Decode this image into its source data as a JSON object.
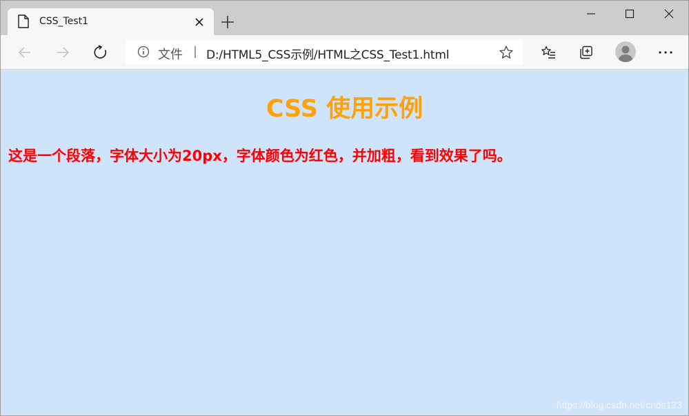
{
  "tab": {
    "title": "CSS_Test1",
    "close_icon": "close-icon",
    "page_icon": "page-icon"
  },
  "window_controls": {
    "minimize_icon": "minimize-icon",
    "maximize_icon": "maximize-icon",
    "close_icon": "close-icon"
  },
  "toolbar": {
    "address": {
      "site_label": "文件",
      "separator": "|",
      "url": "D:/HTML5_CSS示例/HTML之CSS_Test1.html"
    },
    "icons": {
      "back": "back-arrow-icon",
      "forward": "forward-arrow-icon",
      "refresh": "refresh-icon",
      "info": "info-icon",
      "favorite": "star-icon",
      "favorites_list": "favorites-list-icon",
      "collections": "collections-icon",
      "profile": "profile-icon",
      "more": "more-icon"
    }
  },
  "page": {
    "heading": "CSS 使用示例",
    "paragraph": "这是一个段落，字体大小为20px，字体颜色为红色，并加粗，看到效果了吗。",
    "watermark": "https://blog.csdn.net/cnds123"
  },
  "colors": {
    "page_background": "#cfe3fb",
    "heading_color": "#fea20b",
    "paragraph_color": "#ff0000",
    "tabstrip": "#cdcdcd",
    "toolbar": "#f7f7f7"
  }
}
